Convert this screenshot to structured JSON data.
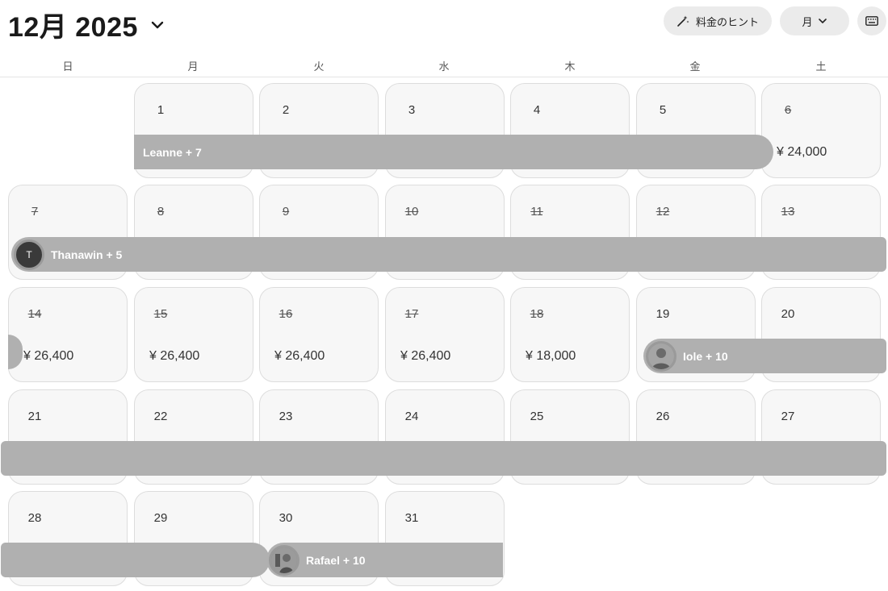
{
  "header": {
    "month_title": "12月 2025",
    "hint_label": "料金のヒント",
    "view_label": "月"
  },
  "weekdays": [
    "日",
    "月",
    "火",
    "水",
    "木",
    "金",
    "土"
  ],
  "days": [
    {
      "day": "1",
      "blocked": false,
      "price": ""
    },
    {
      "day": "2",
      "blocked": false,
      "price": ""
    },
    {
      "day": "3",
      "blocked": false,
      "price": ""
    },
    {
      "day": "4",
      "blocked": false,
      "price": ""
    },
    {
      "day": "5",
      "blocked": false,
      "price": ""
    },
    {
      "day": "6",
      "blocked": true,
      "price": "¥ 24,000"
    },
    {
      "day": "7",
      "blocked": true,
      "price": ""
    },
    {
      "day": "8",
      "blocked": true,
      "price": ""
    },
    {
      "day": "9",
      "blocked": true,
      "price": ""
    },
    {
      "day": "10",
      "blocked": true,
      "price": ""
    },
    {
      "day": "11",
      "blocked": true,
      "price": ""
    },
    {
      "day": "12",
      "blocked": true,
      "price": ""
    },
    {
      "day": "13",
      "blocked": true,
      "price": ""
    },
    {
      "day": "14",
      "blocked": true,
      "price": "¥ 26,400"
    },
    {
      "day": "15",
      "blocked": true,
      "price": "¥ 26,400"
    },
    {
      "day": "16",
      "blocked": true,
      "price": "¥ 26,400"
    },
    {
      "day": "17",
      "blocked": true,
      "price": "¥ 26,400"
    },
    {
      "day": "18",
      "blocked": true,
      "price": "¥ 18,000"
    },
    {
      "day": "19",
      "blocked": false,
      "price": ""
    },
    {
      "day": "20",
      "blocked": false,
      "price": ""
    },
    {
      "day": "21",
      "blocked": false,
      "price": ""
    },
    {
      "day": "22",
      "blocked": false,
      "price": ""
    },
    {
      "day": "23",
      "blocked": false,
      "price": ""
    },
    {
      "day": "24",
      "blocked": false,
      "price": ""
    },
    {
      "day": "25",
      "blocked": false,
      "price": ""
    },
    {
      "day": "26",
      "blocked": false,
      "price": ""
    },
    {
      "day": "27",
      "blocked": false,
      "price": ""
    },
    {
      "day": "28",
      "blocked": false,
      "price": ""
    },
    {
      "day": "29",
      "blocked": false,
      "price": ""
    },
    {
      "day": "30",
      "blocked": false,
      "price": ""
    },
    {
      "day": "31",
      "blocked": false,
      "price": ""
    }
  ],
  "reservations": [
    {
      "label": "Leanne + 7",
      "avatar": "none"
    },
    {
      "label": "Thanawin + 5",
      "avatar": "initial",
      "initial": "T"
    },
    {
      "label": "",
      "avatar": "none"
    },
    {
      "label": "Iole + 10",
      "avatar": "photo"
    },
    {
      "label": "",
      "avatar": "none"
    },
    {
      "label": "",
      "avatar": "none"
    },
    {
      "label": "Rafael + 10",
      "avatar": "photo"
    }
  ],
  "colors": {
    "cell_bg": "#f7f7f7",
    "bar_bg": "#b0b0b0",
    "button_bg": "#ebebeb"
  },
  "icons": [
    "chevron-down-icon",
    "magic-wand-icon",
    "keyboard-icon"
  ]
}
